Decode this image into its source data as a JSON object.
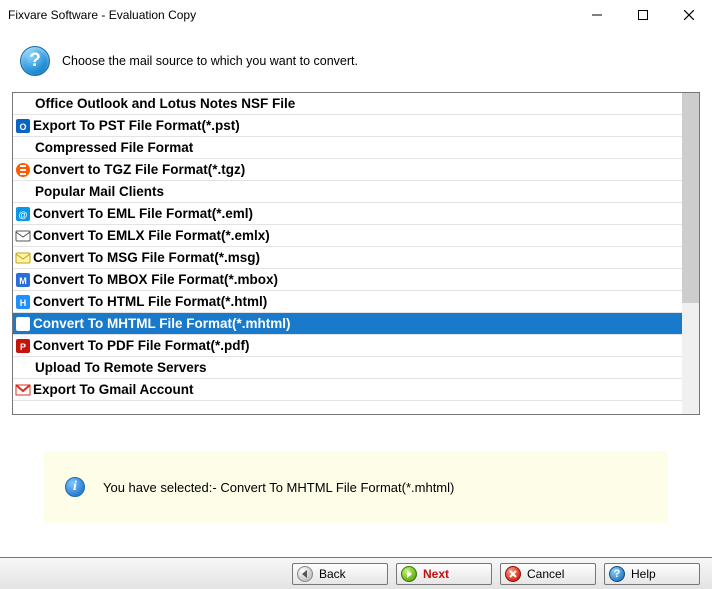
{
  "window": {
    "title": "Fixvare Software - Evaluation Copy"
  },
  "prompt": "Choose the mail source to which you want to convert.",
  "list": [
    {
      "kind": "header",
      "label": "Office Outlook and Lotus Notes NSF File"
    },
    {
      "kind": "item",
      "icon": "pst",
      "label": "Export To PST File Format(*.pst)"
    },
    {
      "kind": "header",
      "label": "Compressed File Format"
    },
    {
      "kind": "item",
      "icon": "tgz",
      "label": "Convert to TGZ File Format(*.tgz)"
    },
    {
      "kind": "header",
      "label": "Popular Mail Clients"
    },
    {
      "kind": "item",
      "icon": "eml",
      "label": "Convert To EML File Format(*.eml)"
    },
    {
      "kind": "item",
      "icon": "emlx",
      "label": "Convert To EMLX File Format(*.emlx)"
    },
    {
      "kind": "item",
      "icon": "msg",
      "label": "Convert To MSG File Format(*.msg)"
    },
    {
      "kind": "item",
      "icon": "mbox",
      "label": "Convert To MBOX File Format(*.mbox)"
    },
    {
      "kind": "item",
      "icon": "html",
      "label": "Convert To HTML File Format(*.html)"
    },
    {
      "kind": "item",
      "icon": "mhtml",
      "label": "Convert To MHTML File Format(*.mhtml)",
      "selected": true
    },
    {
      "kind": "item",
      "icon": "pdf",
      "label": "Convert To PDF File Format(*.pdf)"
    },
    {
      "kind": "header",
      "label": "Upload To Remote Servers"
    },
    {
      "kind": "item",
      "icon": "gmail",
      "label": "Export To Gmail Account"
    }
  ],
  "status": "You have selected:- Convert To MHTML File Format(*.mhtml)",
  "buttons": {
    "back": "Back",
    "next": "Next",
    "cancel": "Cancel",
    "help": "Help"
  }
}
